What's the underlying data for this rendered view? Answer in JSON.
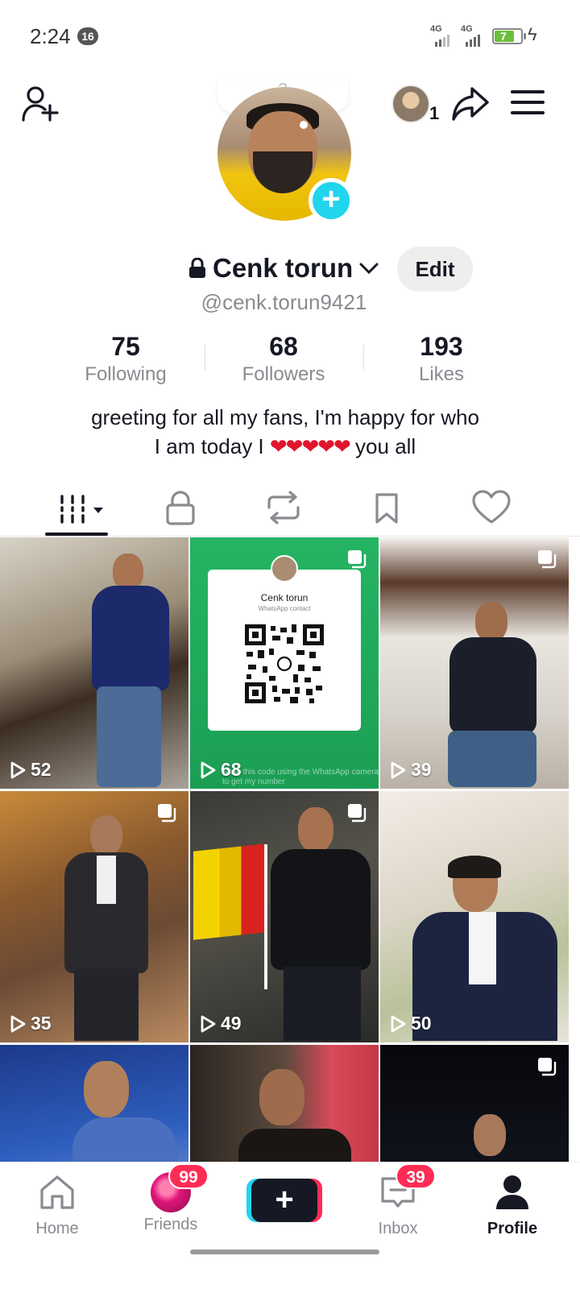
{
  "status_bar": {
    "time": "2:24",
    "notification_count": "16",
    "network_1": "4G",
    "network_2": "4G",
    "battery_level": "7"
  },
  "header": {
    "story_viewer_count": "1",
    "note_placeholder": "?"
  },
  "profile": {
    "display_name": "Cenk torun",
    "username": "@cenk.torun9421",
    "edit_label": "Edit",
    "stats": [
      {
        "value": "75",
        "label": "Following"
      },
      {
        "value": "68",
        "label": "Followers"
      },
      {
        "value": "193",
        "label": "Likes"
      }
    ],
    "bio_line1": "greeting for all my fans, I'm happy for who",
    "bio_line2_start": "I am today I",
    "bio_hearts": "❤❤❤❤❤",
    "bio_line2_end": "you all"
  },
  "videos": [
    {
      "views": "52"
    },
    {
      "views": "68",
      "qr_name": "Cenk torun",
      "qr_sub": "WhatsApp contact",
      "qr_foot": "Scan this code using the WhatsApp camera to get my number"
    },
    {
      "views": "39"
    },
    {
      "views": "35"
    },
    {
      "views": "49"
    },
    {
      "views": "50"
    },
    {
      "views": ""
    },
    {
      "views": ""
    },
    {
      "views": ""
    }
  ],
  "bottom_nav": {
    "home": "Home",
    "friends": "Friends",
    "friends_badge": "99",
    "inbox": "Inbox",
    "inbox_badge": "39",
    "profile": "Profile"
  },
  "colors": {
    "accent_pink": "#fe2c55",
    "accent_cyan": "#20d5ec",
    "text_primary": "#161823",
    "text_secondary": "#8a8b91"
  }
}
